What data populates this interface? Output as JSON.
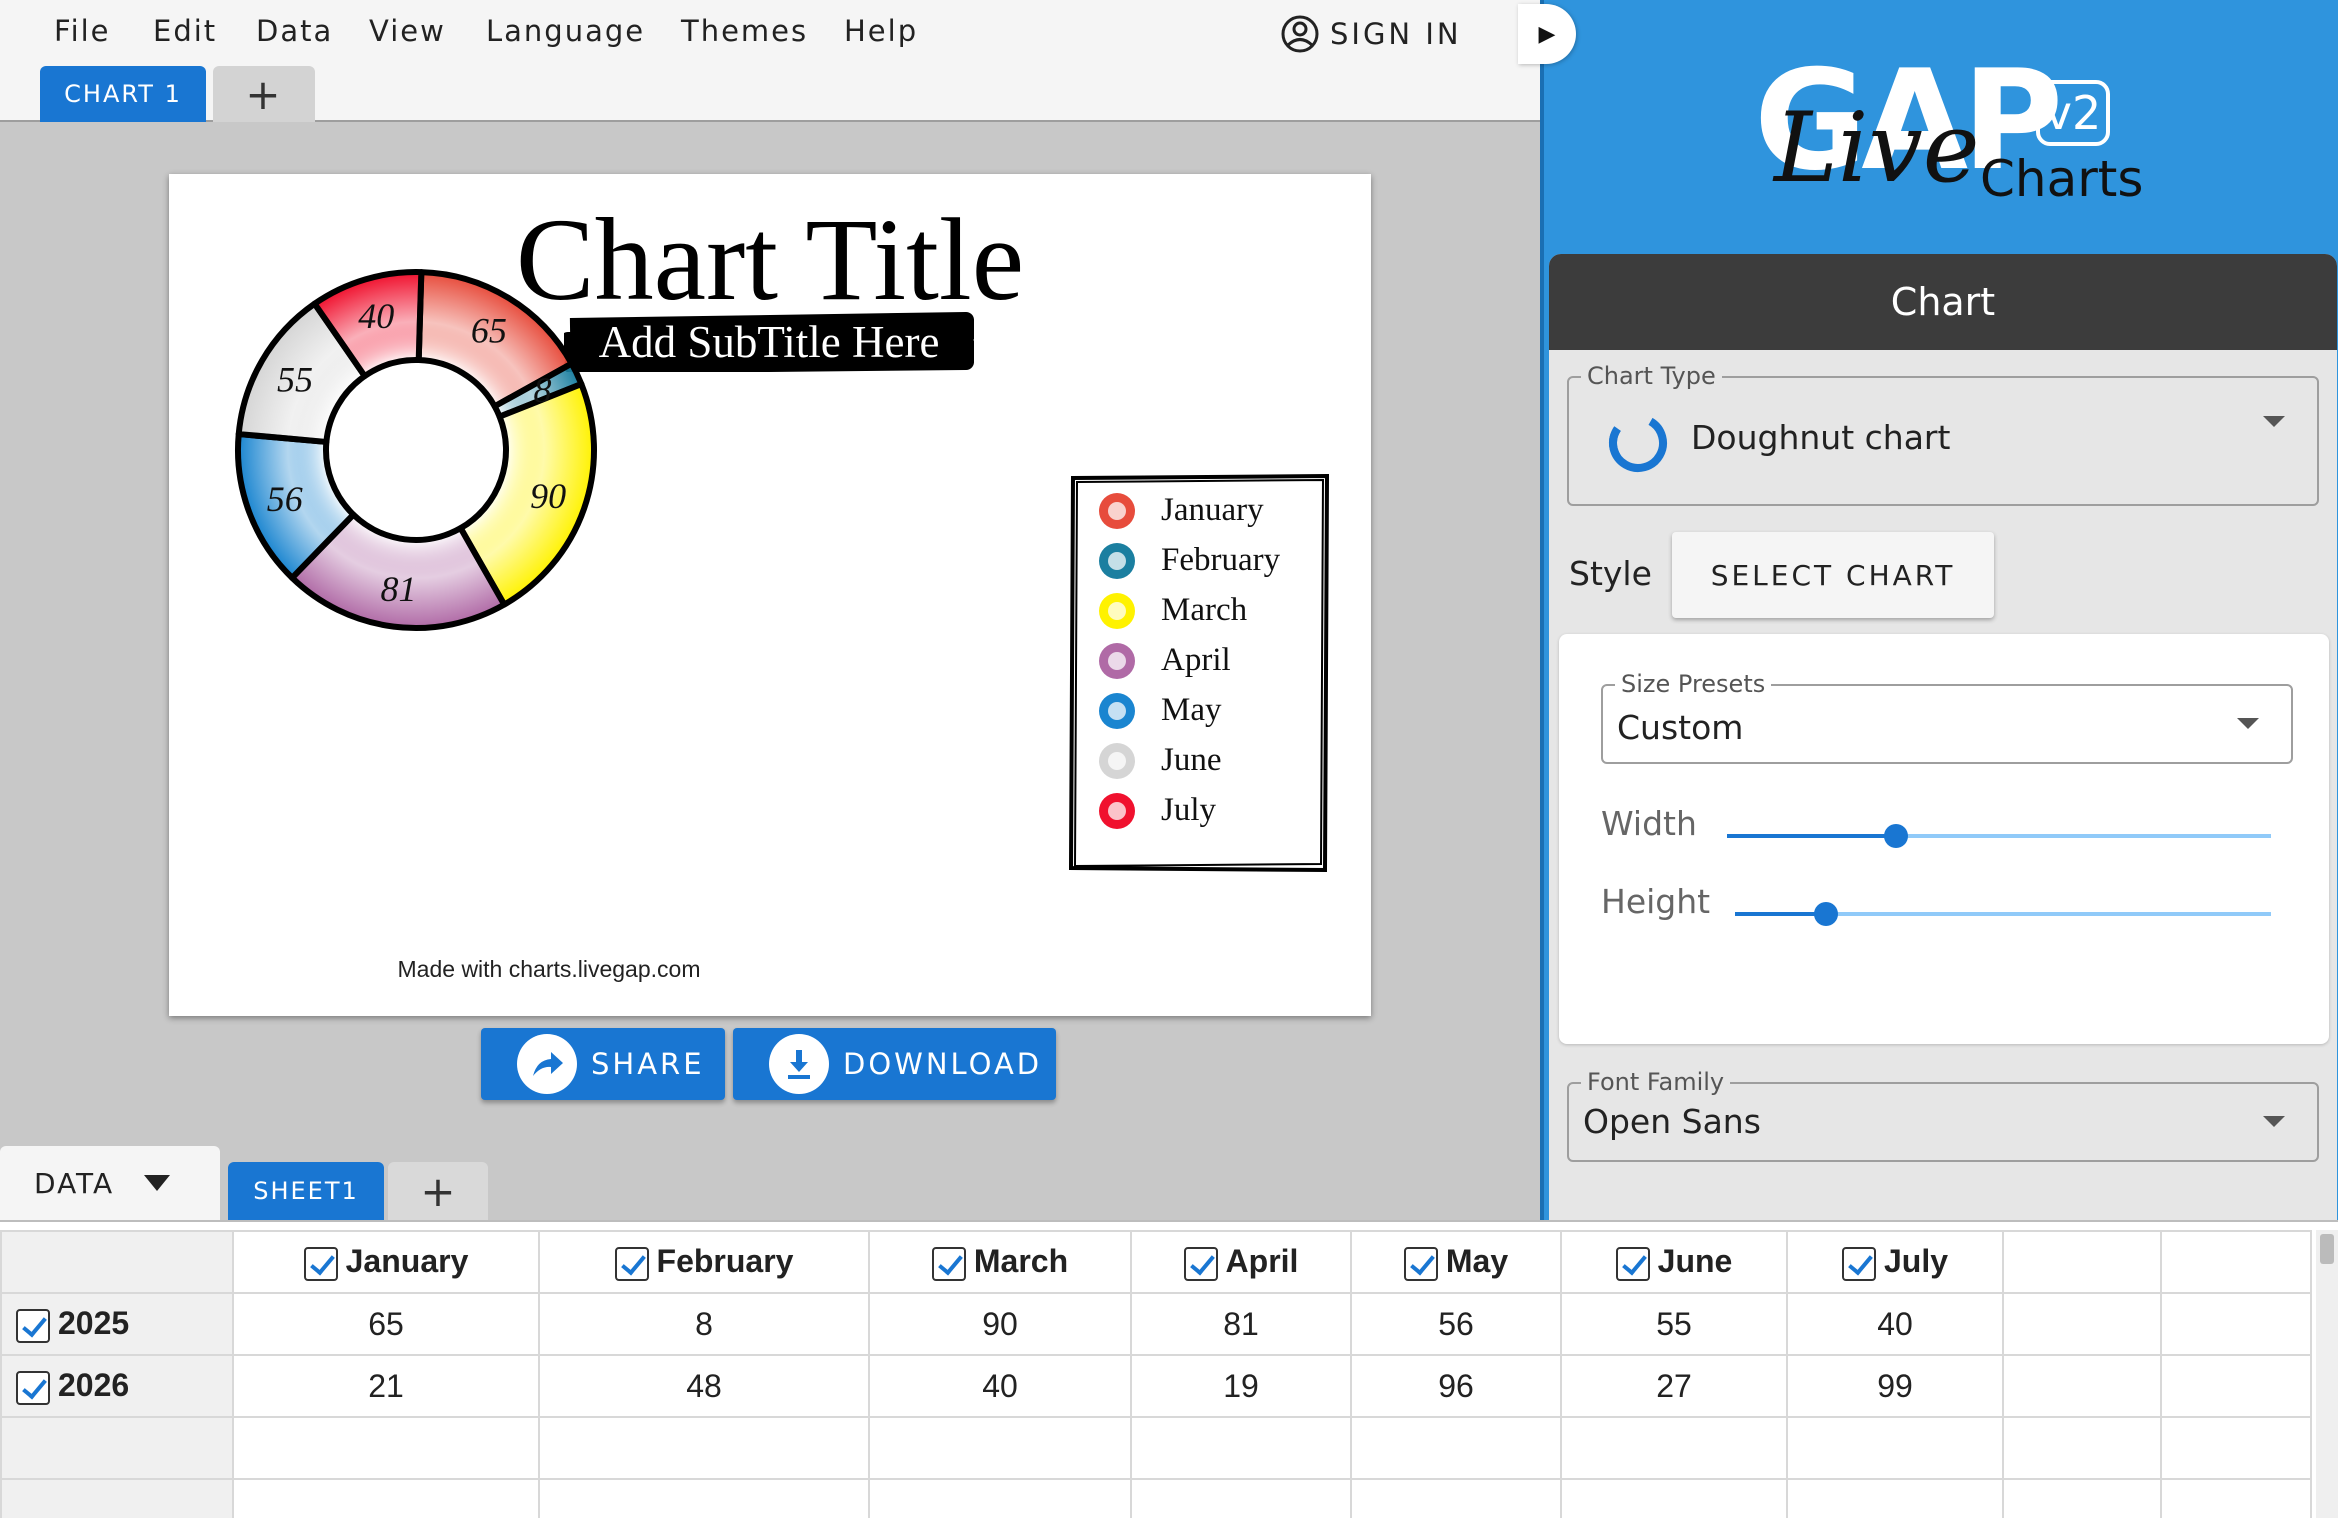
{
  "menu": {
    "items": [
      "File",
      "Edit",
      "Data",
      "View",
      "Language",
      "Themes",
      "Help"
    ],
    "signin_label": "SIGN IN"
  },
  "tabs": {
    "chart_tab": "CHART 1",
    "add_tab": "+"
  },
  "chart": {
    "title": "Chart Title",
    "subtitle": "Add SubTitle Here",
    "watermark": "Made with charts.livegap.com"
  },
  "chart_data": {
    "type": "doughnut",
    "title": "Chart Title",
    "subtitle": "Add SubTitle Here",
    "categories": [
      "January",
      "February",
      "March",
      "April",
      "May",
      "June",
      "July"
    ],
    "series": [
      {
        "name": "2025",
        "values": [
          65,
          8,
          90,
          81,
          56,
          55,
          40
        ]
      }
    ],
    "colors": [
      "#e74c3c",
      "#1b7fa0",
      "#fff200",
      "#b06aa6",
      "#1a85d0",
      "#d5d5d5",
      "#f0112e"
    ],
    "legend_position": "right"
  },
  "actions": {
    "share_label": "SHARE",
    "download_label": "DOWNLOAD"
  },
  "sheets": {
    "data_dropdown": "DATA",
    "sheet1": "SHEET1",
    "add_sheet": "+"
  },
  "grid": {
    "columns": [
      "January",
      "February",
      "March",
      "April",
      "May",
      "June",
      "July"
    ],
    "rows": [
      {
        "label": "2025",
        "values": [
          "65",
          "8",
          "90",
          "81",
          "56",
          "55",
          "40"
        ]
      },
      {
        "label": "2026",
        "values": [
          "21",
          "48",
          "40",
          "19",
          "96",
          "27",
          "99"
        ]
      }
    ]
  },
  "panel": {
    "logo_gap": "GAP",
    "logo_live": "Live",
    "logo_charts": "Charts",
    "logo_version": "v2",
    "header": "Chart",
    "chart_type_label": "Chart Type",
    "chart_type_value": "Doughnut chart",
    "style_label": "Style",
    "select_chart_label": "SELECT CHART",
    "size_presets_label": "Size Presets",
    "size_presets_value": "Custom",
    "width_label": "Width",
    "width_level": 0.31,
    "height_label": "Height",
    "height_level": 0.17,
    "font_family_label": "Font Family",
    "font_family_value": "Open Sans"
  }
}
